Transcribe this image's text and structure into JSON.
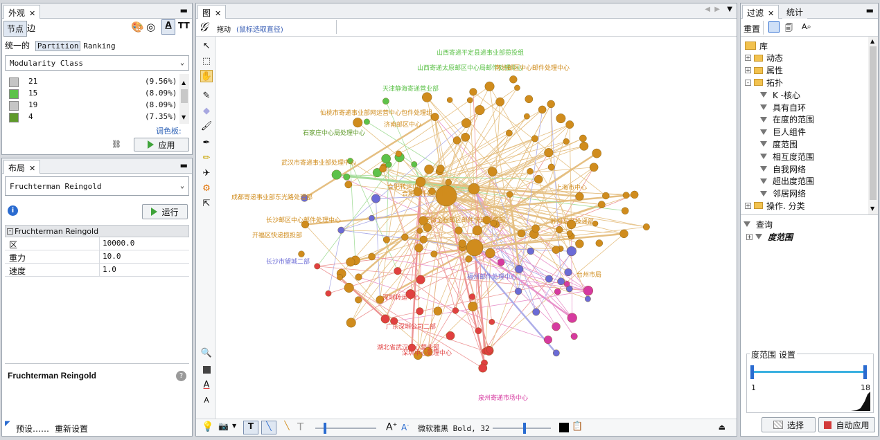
{
  "appearance": {
    "tab_title": "外观",
    "sub_tabs": [
      "节点",
      "边"
    ],
    "mode_tabs": [
      "统一的",
      "Partition",
      "Ranking"
    ],
    "attribute": "Modularity Class",
    "partitions": [
      {
        "id": "21",
        "pct": "(9.56%)",
        "color": "#c5c5c5"
      },
      {
        "id": "15",
        "pct": "(8.09%)",
        "color": "#5dc24a"
      },
      {
        "id": "19",
        "pct": "(8.09%)",
        "color": "#c5c5c5"
      },
      {
        "id": "4",
        "pct": "(7.35%)",
        "color": "#5e9a2a"
      }
    ],
    "palette_link": "调色板:",
    "apply": "应用"
  },
  "layout": {
    "tab_title": "布局",
    "algorithm": "Fruchterman Reingold",
    "run": "运行",
    "section": "Fruchterman Reingold",
    "props": [
      {
        "name": "区",
        "value": "10000.0"
      },
      {
        "name": "重力",
        "value": "10.0"
      },
      {
        "name": "速度",
        "value": "1.0"
      }
    ],
    "desc_title": "Fruchterman Reingold",
    "presets": "预设……",
    "reset": "重新设置"
  },
  "graph": {
    "tab_title": "图",
    "mode": "拖动",
    "hint": "(鼠标选取直径)",
    "font_label": "微软雅黑 Bold, 32",
    "font_sample_big": "A",
    "font_sample_small": "A"
  },
  "filters": {
    "tab1": "过滤",
    "tab2": "统计",
    "reset": "重置",
    "tree": [
      {
        "label": "库",
        "level": 0,
        "kind": "folder"
      },
      {
        "label": "动态",
        "level": 1,
        "kind": "folder",
        "exp": "+"
      },
      {
        "label": "属性",
        "level": 1,
        "kind": "folder",
        "exp": "+"
      },
      {
        "label": "拓扑",
        "level": 1,
        "kind": "folder",
        "exp": "-"
      },
      {
        "label": "K -核心",
        "level": 2,
        "kind": "filter"
      },
      {
        "label": "具有自环",
        "level": 2,
        "kind": "filter"
      },
      {
        "label": "在度的范围",
        "level": 2,
        "kind": "filter"
      },
      {
        "label": "巨人组件",
        "level": 2,
        "kind": "filter"
      },
      {
        "label": "度范围",
        "level": 2,
        "kind": "filter"
      },
      {
        "label": "相互度范围",
        "level": 2,
        "kind": "filter"
      },
      {
        "label": "自我网络",
        "level": 2,
        "kind": "filter"
      },
      {
        "label": "超出度范围",
        "level": 2,
        "kind": "filter"
      },
      {
        "label": "邻居网络",
        "level": 2,
        "kind": "filter"
      },
      {
        "label": "操作. 分类",
        "level": 1,
        "kind": "folder",
        "exp": "+"
      }
    ],
    "query_title": "查询",
    "query_item": "度范围",
    "settings_title": "度范围 设置",
    "range_min": "1",
    "range_max": "18",
    "select_btn": "选择",
    "auto_apply_btn": "自动应用"
  },
  "network": {
    "nodes": [
      {
        "label": "山西寄递平定县递事业部揽投组",
        "color": "#5dc24a"
      },
      {
        "label": "山西寄递太原邮区中心局邮件处理中心",
        "color": "#5dc24a"
      },
      {
        "label": "天津静海寄递营业部",
        "color": "#5dc24a"
      },
      {
        "label": "南坊邮区中心邮件处理中心",
        "color": "#d08c1d"
      },
      {
        "label": "仙桃市寄递事业部网运营中心包件处理组",
        "color": "#d08c1d"
      },
      {
        "label": "济南邮区中心",
        "color": "#d08c1d"
      },
      {
        "label": "石家庄中心局处理中心",
        "color": "#5e9a2a"
      },
      {
        "label": "武汉市寄递事业部处理中心",
        "color": "#d08c1d"
      },
      {
        "label": "成都寄递事业部东光路处理部",
        "color": "#d08c1d"
      },
      {
        "label": "长沙邮区中心邮件处理中心",
        "color": "#d08c1d"
      },
      {
        "label": "开福区快递揽投部",
        "color": "#d08c1d"
      },
      {
        "label": "长沙市望城二部",
        "color": "#6b6bd6"
      },
      {
        "label": "合肥转运中心",
        "color": "#d08c1d"
      },
      {
        "label": "合肥邮件处理中心",
        "color": "#d08c1d"
      },
      {
        "label": "安徽全程邮区邮件快递服务部",
        "color": "#d08c1d"
      },
      {
        "label": "深圳转运中心",
        "color": "#e04040"
      },
      {
        "label": "广东深圳公司二部",
        "color": "#e04040"
      },
      {
        "label": "湖北省武汉中心营业部",
        "color": "#e04040"
      },
      {
        "label": "深圳中心处理中心",
        "color": "#e04040"
      },
      {
        "label": "泉州寄递市场中心",
        "color": "#d63aa0"
      },
      {
        "label": "福州邮件处理中心",
        "color": "#6b6bd6"
      },
      {
        "label": "台州市局",
        "color": "#d08c1d"
      },
      {
        "label": "上海市中心",
        "color": "#d08c1d"
      },
      {
        "label": "苏州东区投递部",
        "color": "#d08c1d"
      }
    ]
  }
}
